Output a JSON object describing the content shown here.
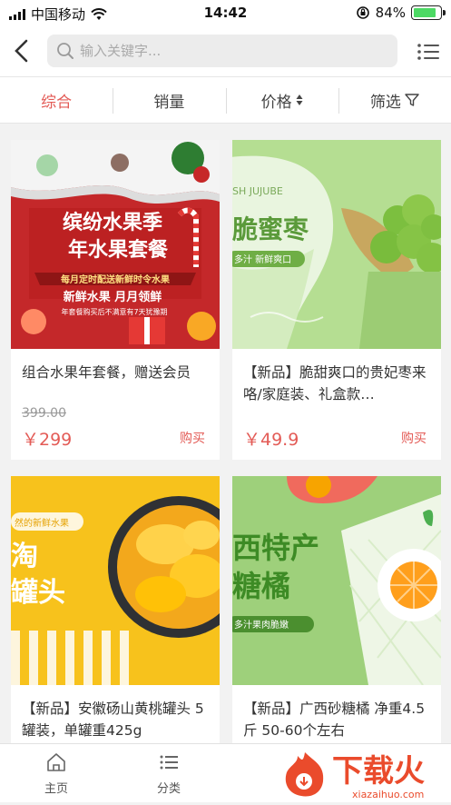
{
  "status_bar": {
    "carrier": "中国移动",
    "time": "14:42",
    "battery": "84%"
  },
  "search": {
    "placeholder": "输入关键字..."
  },
  "filters": [
    {
      "label": "综合",
      "active": true
    },
    {
      "label": "销量"
    },
    {
      "label": "价格"
    },
    {
      "label": "筛选"
    }
  ],
  "products": [
    {
      "name": "组合水果年套餐，赠送会员",
      "original_price": "399.00",
      "price": "￥299",
      "buy": "购买",
      "banner": {
        "line1": "缤纷水果季",
        "line2": "年水果套餐",
        "ribbon": "每月定时配送新鲜时令水果",
        "line3": "新鲜水果  月月领鲜",
        "note": "年套餐购买后不满意有7天犹豫期"
      }
    },
    {
      "name": "【新品】脆甜爽口的贵妃枣来咯/家庭装、礼盒款…",
      "price": "￥49.9",
      "buy": "购买",
      "banner": {
        "tag": "SH JUJUBE",
        "title": "脆蜜枣",
        "sub": "多汁 新鲜爽口"
      }
    },
    {
      "name": "【新品】安徽砀山黄桃罐头 5罐装，单罐重425g",
      "banner": {
        "tag": "然的新鲜水果",
        "line1": "淘",
        "line2": "罐头"
      }
    },
    {
      "name": "【新品】广西砂糖橘 净重4.5斤 50-60个左右",
      "banner": {
        "line1": "西特产",
        "line2": "糖橘",
        "sub": "多汁果肉脆嫩"
      }
    }
  ],
  "tabbar": [
    {
      "label": "主页"
    },
    {
      "label": "分类"
    }
  ],
  "watermark": {
    "text": "下载火",
    "url": "xiazaihuo.com"
  }
}
